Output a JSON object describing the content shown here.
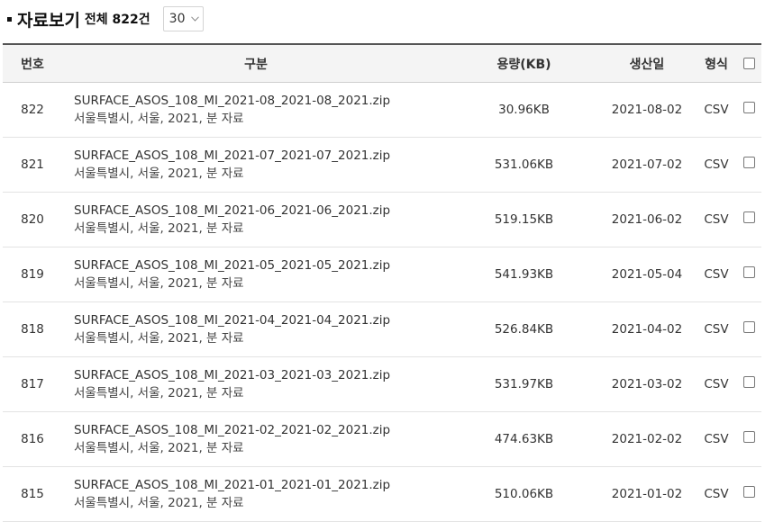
{
  "header": {
    "title": "자료보기",
    "total_label": "전체 822건",
    "page_size": "30"
  },
  "columns": {
    "num": "번호",
    "name": "구분",
    "size": "용량(KB)",
    "date": "생산일",
    "format": "형식"
  },
  "rows": [
    {
      "num": "822",
      "file": "SURFACE_ASOS_108_MI_2021-08_2021-08_2021.zip",
      "desc": "서울특별시, 서울, 2021, 분 자료",
      "size": "30.96KB",
      "date": "2021-08-02",
      "format": "CSV"
    },
    {
      "num": "821",
      "file": "SURFACE_ASOS_108_MI_2021-07_2021-07_2021.zip",
      "desc": "서울특별시, 서울, 2021, 분 자료",
      "size": "531.06KB",
      "date": "2021-07-02",
      "format": "CSV"
    },
    {
      "num": "820",
      "file": "SURFACE_ASOS_108_MI_2021-06_2021-06_2021.zip",
      "desc": "서울특별시, 서울, 2021, 분 자료",
      "size": "519.15KB",
      "date": "2021-06-02",
      "format": "CSV"
    },
    {
      "num": "819",
      "file": "SURFACE_ASOS_108_MI_2021-05_2021-05_2021.zip",
      "desc": "서울특별시, 서울, 2021, 분 자료",
      "size": "541.93KB",
      "date": "2021-05-04",
      "format": "CSV"
    },
    {
      "num": "818",
      "file": "SURFACE_ASOS_108_MI_2021-04_2021-04_2021.zip",
      "desc": "서울특별시, 서울, 2021, 분 자료",
      "size": "526.84KB",
      "date": "2021-04-02",
      "format": "CSV"
    },
    {
      "num": "817",
      "file": "SURFACE_ASOS_108_MI_2021-03_2021-03_2021.zip",
      "desc": "서울특별시, 서울, 2021, 분 자료",
      "size": "531.97KB",
      "date": "2021-03-02",
      "format": "CSV"
    },
    {
      "num": "816",
      "file": "SURFACE_ASOS_108_MI_2021-02_2021-02_2021.zip",
      "desc": "서울특별시, 서울, 2021, 분 자료",
      "size": "474.63KB",
      "date": "2021-02-02",
      "format": "CSV"
    },
    {
      "num": "815",
      "file": "SURFACE_ASOS_108_MI_2021-01_2021-01_2021.zip",
      "desc": "서울특별시, 서울, 2021, 분 자료",
      "size": "510.06KB",
      "date": "2021-01-02",
      "format": "CSV"
    }
  ]
}
